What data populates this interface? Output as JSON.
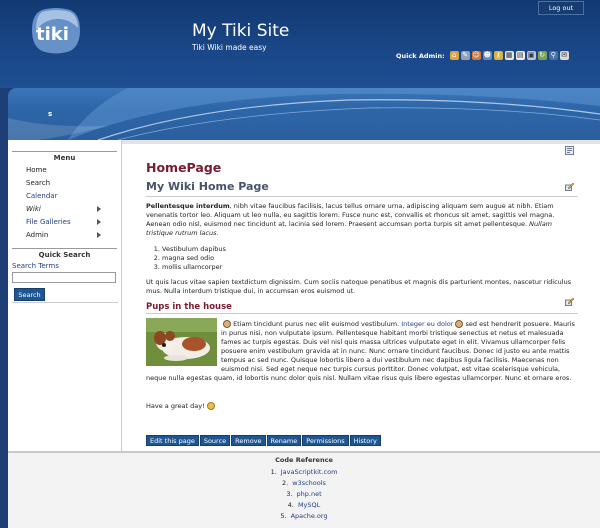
{
  "header": {
    "logo_text": "tiki",
    "site_title": "My Tiki Site",
    "site_slogan": "Tiki Wiki made easy",
    "logout_label": "Log out",
    "quick_admin_label": "Quick Admin:",
    "quick_admin_icons": [
      "house-icon",
      "tools-icon",
      "users-icon",
      "group-icon",
      "key-icon",
      "modules-icon",
      "page-icon",
      "image-icon",
      "refresh-icon",
      "search-icon",
      "mail-icon"
    ]
  },
  "band": {
    "label": "s"
  },
  "sidebar": {
    "menu_title": "Menu",
    "items": [
      {
        "label": "Home",
        "submenu": false,
        "style": "plain"
      },
      {
        "label": "Search",
        "submenu": false,
        "style": "plain"
      },
      {
        "label": "Calendar",
        "submenu": false,
        "style": "link"
      },
      {
        "label": "Wiki",
        "submenu": true,
        "style": "italic"
      },
      {
        "label": "File Galleries",
        "submenu": true,
        "style": "link"
      },
      {
        "label": "Admin",
        "submenu": true,
        "style": "plain"
      }
    ],
    "search_title": "Quick Search",
    "search_label": "Search Terms",
    "search_value": "",
    "search_button": "Search"
  },
  "main": {
    "title": "HomePage",
    "heading": "My Wiki Home Page",
    "intro_bold": "Pellentesque interdum",
    "intro_text": ", nibh vitae faucibus facilisis, lacus tellus ornare urna, adipiscing aliquam sem augue at nibh. Etiam venenatis tortor leo. Aliquam ut leo nulla, eu sagittis lorem. Fusce nunc est, convallis et rhoncus sit amet, sagittis vel magna. Aenean odio nisl, euismod nec tincidunt at, lacinia sed lorem. Praesent accumsan porta turpis sit amet pellentesque. ",
    "intro_italic": "Nullam tristique rutrum lacus.",
    "list_items": [
      "Vestibulum dapibus",
      "magna sed odio",
      "mollis ullamcorper"
    ],
    "para2": "Ut quis lacus vitae sapien textdictum dignissim. Cum sociis natoque penatibus et magnis dis parturient montes, nascetur ridiculus mus. Nulla interdum tristique dui, in accumsan eros euismod ut.",
    "pups_heading": "Pups in the house",
    "pups_text_a": "Etiam tincidunt purus nec elit euismod vestibulum. ",
    "pups_link": "Integer eu dolor",
    "pups_text_b": " sed est hendrerit posuere. Mauris in purus nisi, non vulputate ipsum. Pellentesque habitant morbi tristique senectus et netus et malesuada fames ac turpis egestas. Duis vel nisl quis massa ultrices vulputate eget in elit. Vivamus ullamcorper felis posuere enim vestibulum gravida at in nunc. Nunc ornare tincidunt faucibus. Donec id justo eu ante mattis tempus ac sed nunc. Quisque lobortis libero a dui vestibulum nec dapibus ligula facilisis. Maecenas non euismod nisi. Sed eget neque nec turpis cursus porttitor. Donec volutpat, est vitae scelerisque vehicula, neque nulla egestas quam, id lobortis nunc dolor quis nisl. Nullam vitae risus quis libero egestas ullamcorper. Nunc et ornare eros.",
    "goodbye": "Have a great day!",
    "actions": [
      "Edit this page",
      "Source",
      "Remove",
      "Rename",
      "Permissions",
      "History"
    ]
  },
  "footer": {
    "title": "Code Reference",
    "links": [
      "JavaScriptkit.com",
      "w3schools",
      "php.net",
      "MySQL",
      "Apache.org"
    ]
  }
}
